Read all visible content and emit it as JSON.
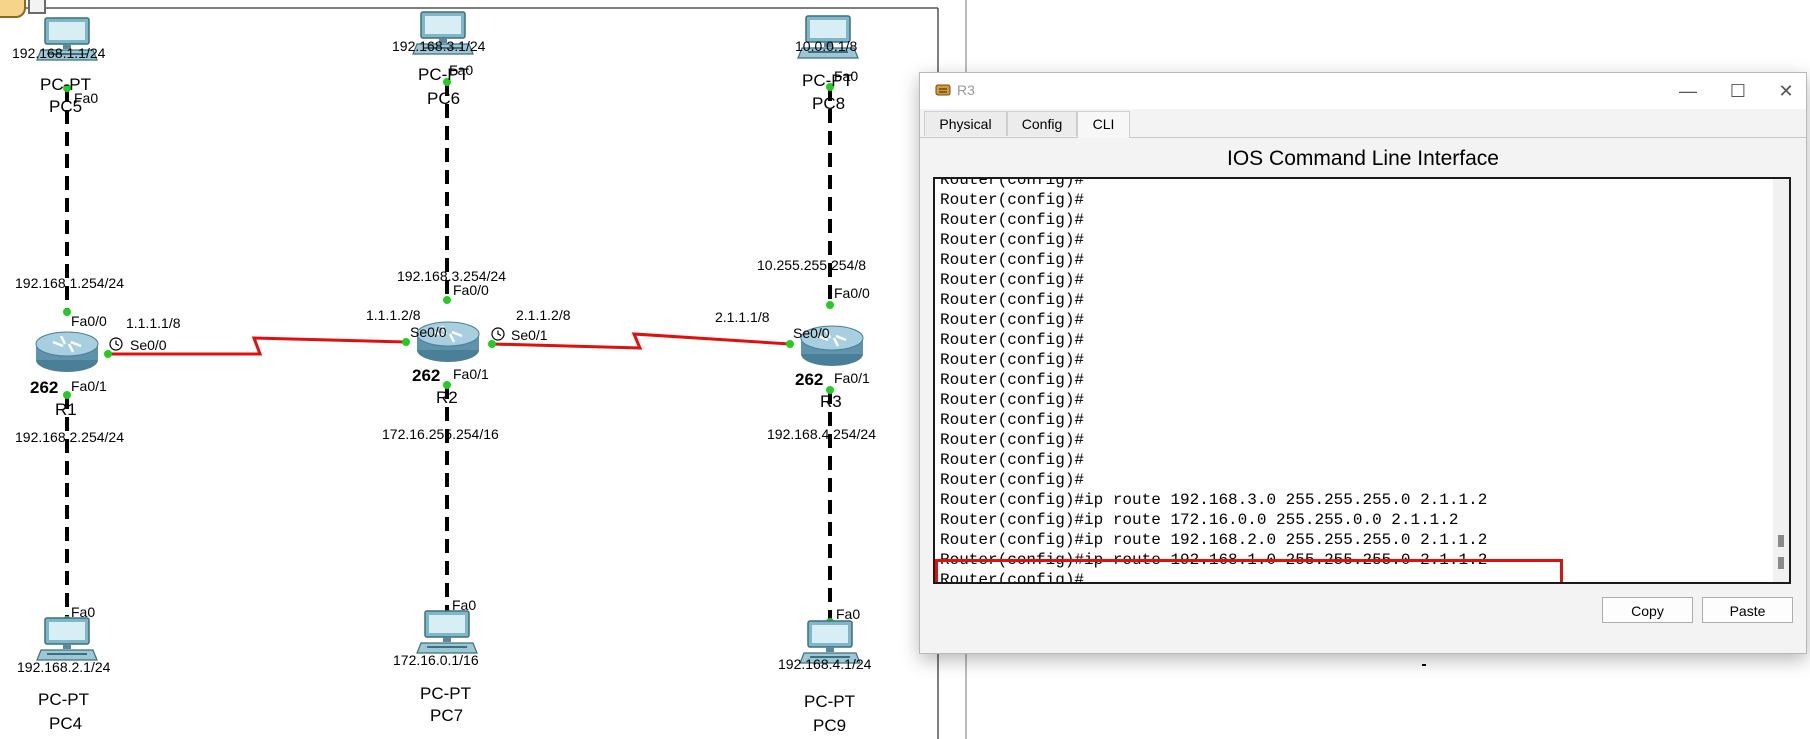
{
  "topology": {
    "pcs": [
      {
        "id": "pc5",
        "ip": "192.168.1.1/24",
        "model": "PC-PT",
        "name": "PC5",
        "port": "Fa0"
      },
      {
        "id": "pc6",
        "ip": "192.168.3.1/24",
        "model": "PC-PT",
        "name": "PC6",
        "port": "Fa0"
      },
      {
        "id": "pc8",
        "ip": "10.0.0.1/8",
        "model": "PC-PT",
        "name": "PC8",
        "port": "Fa0"
      },
      {
        "id": "pc4",
        "ip": "192.168.2.1/24",
        "model": "PC-PT",
        "name": "PC4",
        "port": "Fa0"
      },
      {
        "id": "pc7",
        "ip": "172.16.0.1/16",
        "model": "PC-PT",
        "name": "PC7",
        "port": "Fa0"
      },
      {
        "id": "pc9",
        "ip": "192.168.4.1/24",
        "model": "PC-PT",
        "name": "PC9",
        "port": "Fa0"
      }
    ],
    "routers": [
      {
        "id": "r1",
        "model": "262",
        "name": "R1",
        "fa00": "Fa0/0",
        "fa01": "Fa0/1",
        "serial": "Se0/0",
        "lan_top_ip": "192.168.1.254/24",
        "lan_bottom_ip": "192.168.2.254/24",
        "serial_ip": "1.1.1.1/8"
      },
      {
        "id": "r2",
        "model": "262",
        "name": "R2",
        "fa00": "Fa0/0",
        "fa01": "Fa0/1",
        "serial_left": "Se0/0",
        "serial_right": "Se0/1",
        "lan_top_ip": "192.168.3.254/24",
        "lan_bottom_ip": "172.16.255.254/16",
        "serial_left_ip": "1.1.1.2/8",
        "serial_right_ip": "2.1.1.2/8"
      },
      {
        "id": "r3",
        "model": "262",
        "name": "R3",
        "fa00": "Fa0/0",
        "fa01": "Fa0/1",
        "serial": "Se0/0",
        "lan_top_ip": "10.255.255.254/8",
        "lan_bottom_ip": "192.168.4.254/24",
        "serial_ip": "2.1.1.1/8"
      }
    ]
  },
  "window": {
    "title": "R3",
    "tabs": [
      "Physical",
      "Config",
      "CLI"
    ],
    "active_tab": "CLI",
    "heading": "IOS Command Line Interface",
    "controls": {
      "minimize": "—",
      "maximize": "☐",
      "close": "✕"
    },
    "terminal_lines": [
      "Router(config)#",
      "Router(config)#",
      "Router(config)#",
      "Router(config)#",
      "Router(config)#",
      "Router(config)#",
      "Router(config)#",
      "Router(config)#",
      "Router(config)#",
      "Router(config)#",
      "Router(config)#",
      "Router(config)#",
      "Router(config)#",
      "Router(config)#",
      "Router(config)#",
      "Router(config)#",
      "Router(config)#",
      "Router(config)#",
      "Router(config)#",
      "Router(config)#",
      "Router(config)#",
      "Router(config)#",
      "Router(config)#",
      "Router(config)#",
      "Router(config)#",
      "Router(config)#",
      "Router(config)#",
      "Router(config)#",
      "Router(config)#",
      "Router(config)#",
      "Router(config)#",
      "Router(config)#",
      "Router(config)#ip route 192.168.3.0 255.255.255.0 2.1.1.2",
      "Router(config)#ip route 172.16.0.0 255.255.0.0 2.1.1.2",
      "Router(config)#ip route 192.168.2.0 255.255.255.0 2.1.1.2",
      "Router(config)#ip route 192.168.1.0 255.255.255.0 2.1.1.2",
      "Router(config)#"
    ],
    "buttons": {
      "copy": "Copy",
      "paste": "Paste"
    }
  },
  "colors": {
    "serial_link": "#e01010",
    "link_dot": "#22cc22",
    "highlight": "#e01010"
  }
}
